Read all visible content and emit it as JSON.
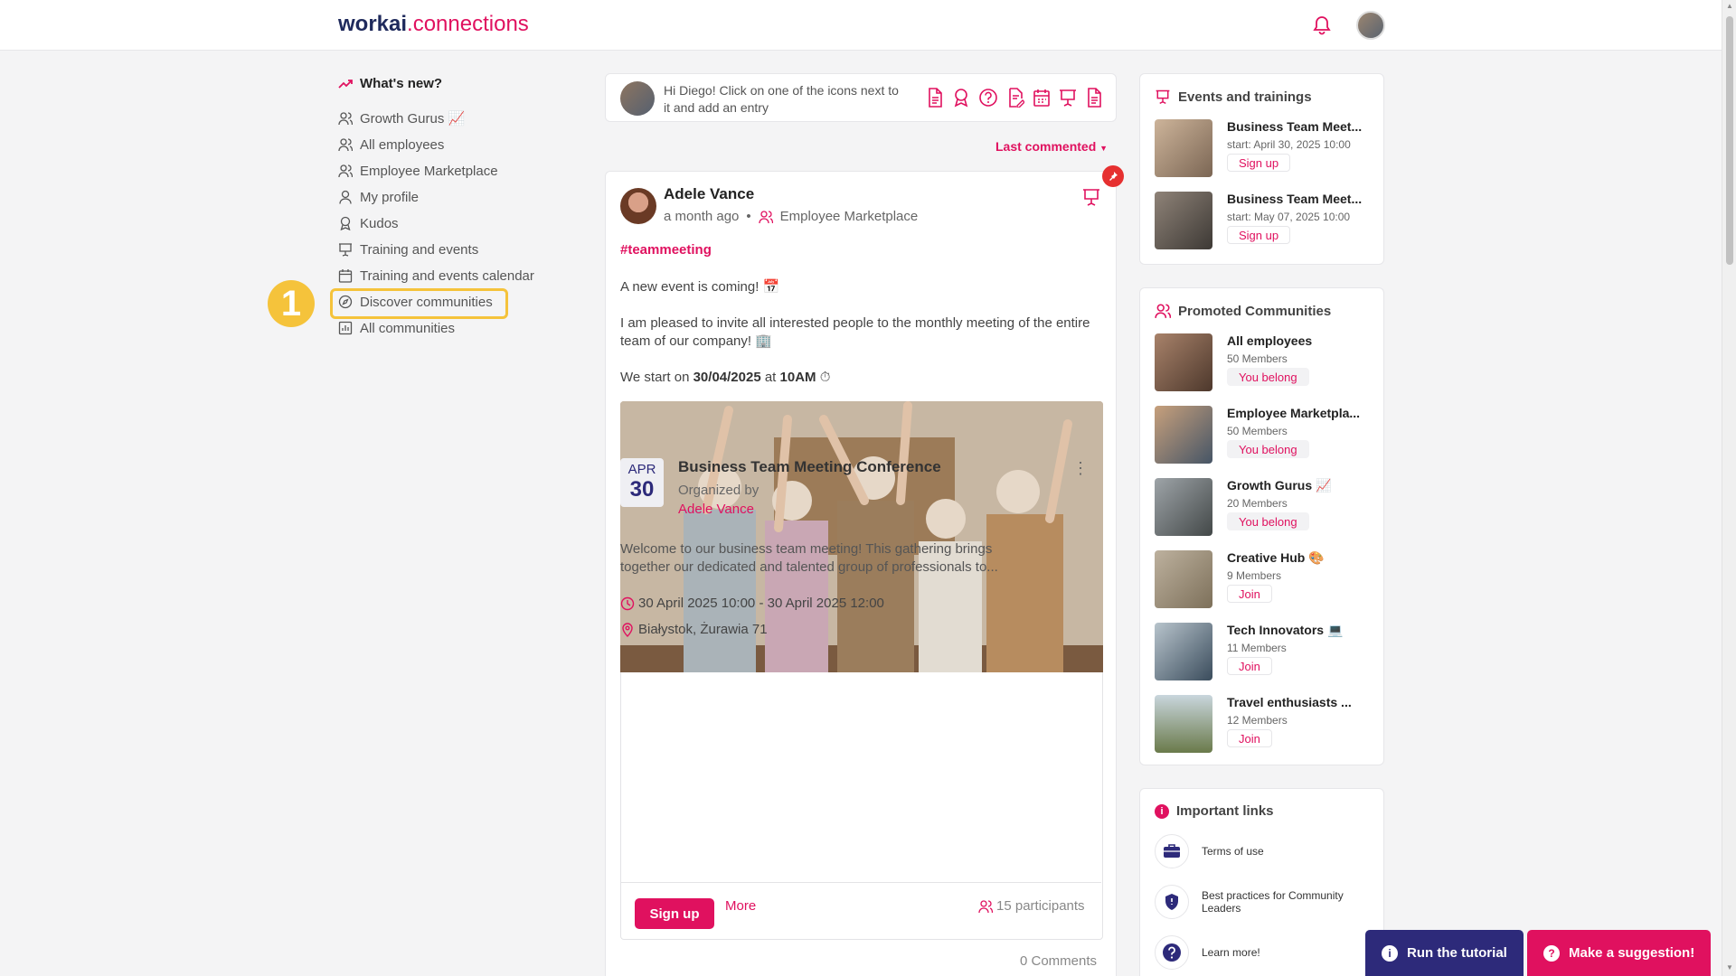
{
  "header": {
    "logo_main": "workai",
    "logo_accent": ".connections"
  },
  "sidebar": {
    "heading": "What's new?",
    "items": [
      {
        "label": "Growth Gurus 📈"
      },
      {
        "label": "All employees"
      },
      {
        "label": "Employee Marketplace"
      },
      {
        "label": "My profile"
      },
      {
        "label": "Kudos"
      },
      {
        "label": "Training and events"
      },
      {
        "label": "Training and events calendar"
      },
      {
        "label": "Discover communities"
      },
      {
        "label": "All communities"
      }
    ],
    "step_number": "1"
  },
  "composer": {
    "prompt": "Hi Diego! Click on one of the icons next to it and add an entry"
  },
  "sort": {
    "label": "Last commented"
  },
  "post": {
    "author": "Adele Vance",
    "time": "a month ago",
    "community": "Employee Marketplace",
    "hashtag": "#teammeeting",
    "line1": "A new event is coming! 📅",
    "line2": "I am pleased to invite all interested people to the monthly meeting of the entire team of our company! 🏢",
    "start_prefix": "We start on",
    "start_date": "30/04/2025",
    "start_at": "at",
    "start_time": "10AM",
    "start_suffix": "⏱",
    "event": {
      "month": "APR",
      "day": "30",
      "title": "Business Team Meeting Conference",
      "organized_by": "Organized by",
      "organizer": "Adele Vance",
      "description": "Welcome to our business team meeting! This gathering brings together our dedicated and talented group of professionals to...",
      "when": "30 April 2025 10:00 - 30 April 2025 12:00",
      "where": "Białystok, Żurawia 71",
      "signup": "Sign up",
      "more": "More",
      "participants": "15 participants"
    },
    "comments": "0 Comments"
  },
  "events_card": {
    "title": "Events and trainings",
    "items": [
      {
        "title": "Business Team Meet...",
        "sub": "start: April 30, 2025 10:00",
        "btn": "Sign up"
      },
      {
        "title": "Business Team Meet...",
        "sub": "start: May 07, 2025 10:00",
        "btn": "Sign up"
      }
    ]
  },
  "communities_card": {
    "title": "Promoted Communities",
    "items": [
      {
        "title": "All employees",
        "sub": "50 Members",
        "btn": "You belong"
      },
      {
        "title": "Employee Marketpla...",
        "sub": "50 Members",
        "btn": "You belong"
      },
      {
        "title": "Growth Gurus 📈",
        "sub": "20 Members",
        "btn": "You belong"
      },
      {
        "title": "Creative Hub 🎨",
        "sub": "9 Members",
        "btn": "Join"
      },
      {
        "title": "Tech Innovators 💻",
        "sub": "11 Members",
        "btn": "Join"
      },
      {
        "title": "Travel enthusiasts ...",
        "sub": "12 Members",
        "btn": "Join"
      }
    ]
  },
  "links_card": {
    "title": "Important links",
    "items": [
      {
        "label": "Terms of use"
      },
      {
        "label": "Best practices for Community Leaders"
      },
      {
        "label": "Learn more!"
      }
    ]
  },
  "floating": {
    "tutorial": "Run the tutorial",
    "suggest": "Make a suggestion!"
  },
  "colors": {
    "accent": "#e0115f",
    "navy": "#2d2a7a",
    "highlight": "#f5c33b"
  }
}
